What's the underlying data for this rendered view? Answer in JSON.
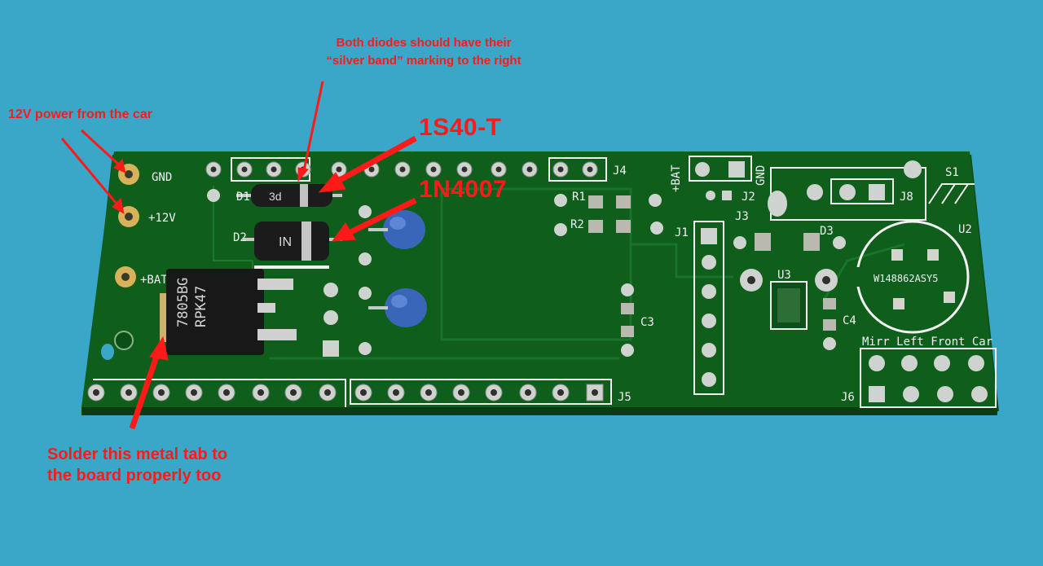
{
  "annotations": {
    "diodes_note": "Both diodes should have their\n“silver band” marking to the right",
    "power_note": "12V power from the car",
    "diode1_part": "1S40-T",
    "diode2_part": "1N4007",
    "tab_note": "Solder this metal tab to\nthe board properly too"
  },
  "board": {
    "pads": {
      "gnd": "GND",
      "v12": "+12V",
      "bat": "+BAT"
    },
    "refs": {
      "d1": "D1",
      "d2": "D2",
      "d3": "D3",
      "r1": "R1",
      "r2": "R2",
      "c3": "C3",
      "c4": "C4",
      "j1": "J1",
      "j2": "J2",
      "j3": "J3",
      "j4": "J4",
      "j5": "J5",
      "j6": "J6",
      "j8": "J8",
      "s1": "S1",
      "u2": "U2",
      "u3": "U3",
      "bat_top": "+BAT",
      "gnd_top": "GND"
    },
    "j6_label": "Mirr  Left Front Car",
    "regulator_marking": [
      "7805BG",
      "RPK47"
    ],
    "diode_markings": {
      "d1": "3d",
      "d2": "IN"
    },
    "u2_marking": "W148862ASY5"
  },
  "colors": {
    "background": "#3aa6c8",
    "board": "#0c5a19",
    "silkscreen": "#f2f2f2",
    "annotation": "#ff1a1a"
  }
}
